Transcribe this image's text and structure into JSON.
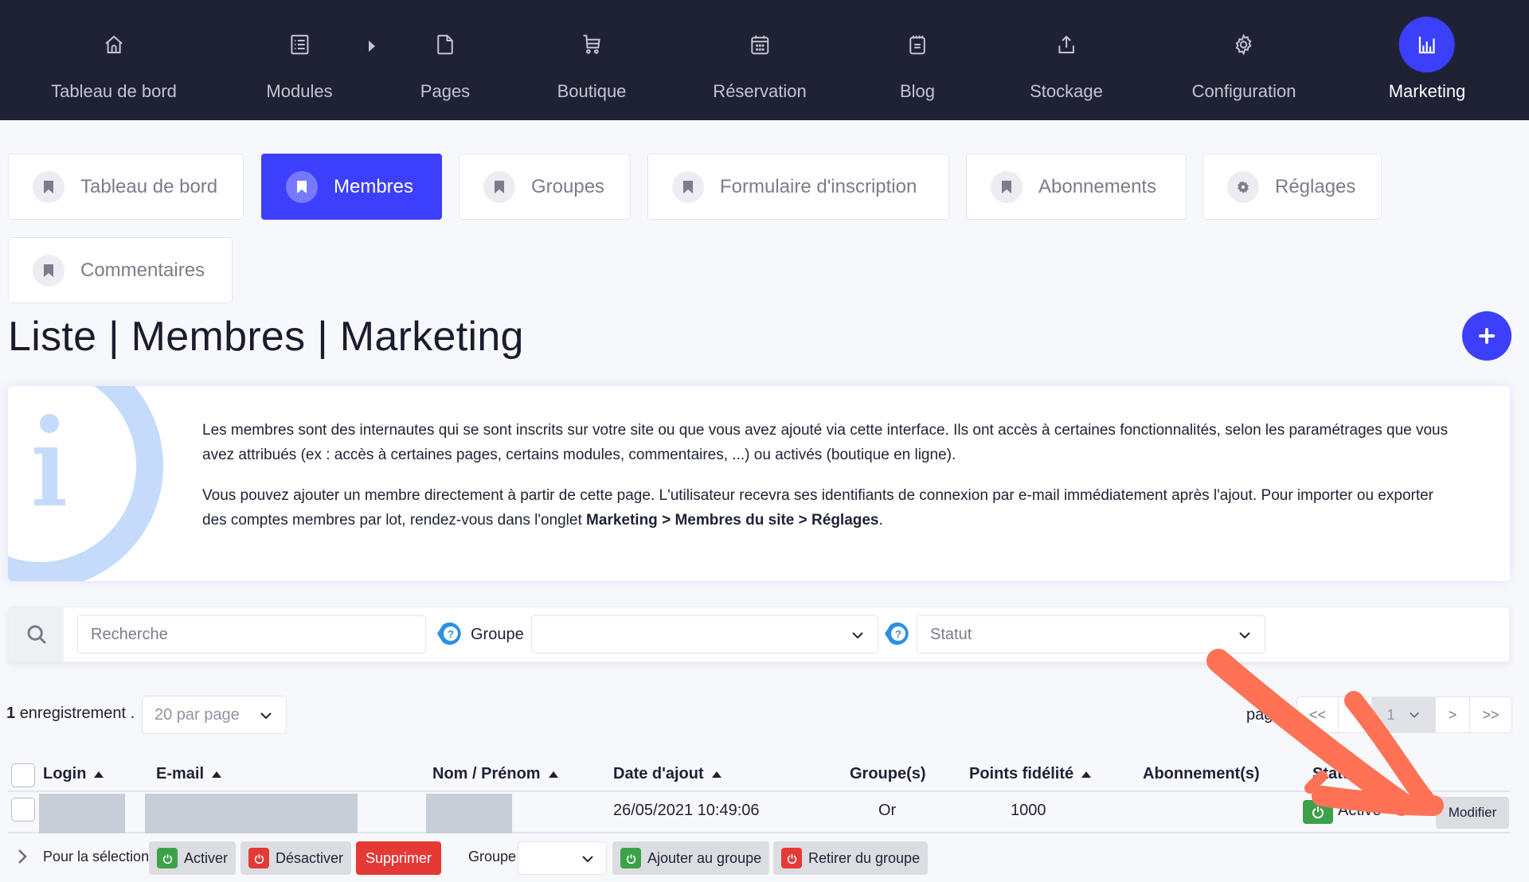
{
  "topnav": {
    "items": [
      {
        "label": "Tableau de bord",
        "icon": "home-icon"
      },
      {
        "label": "Modules",
        "icon": "list-icon"
      },
      {
        "label": "Pages",
        "icon": "page-icon"
      },
      {
        "label": "Boutique",
        "icon": "cart-icon"
      },
      {
        "label": "Réservation",
        "icon": "calendar-icon"
      },
      {
        "label": "Blog",
        "icon": "notepad-icon"
      },
      {
        "label": "Stockage",
        "icon": "upload-icon"
      },
      {
        "label": "Configuration",
        "icon": "gear-icon"
      },
      {
        "label": "Marketing",
        "icon": "bar-chart-icon",
        "active": true
      }
    ],
    "accent": "#3c3ffb",
    "background": "#1f2235"
  },
  "subtabs": [
    {
      "label": "Tableau de bord",
      "icon": "bookmark-icon"
    },
    {
      "label": "Membres",
      "icon": "bookmark-icon",
      "active": true
    },
    {
      "label": "Groupes",
      "icon": "bookmark-icon"
    },
    {
      "label": "Formulaire d'inscription",
      "icon": "bookmark-icon"
    },
    {
      "label": "Abonnements",
      "icon": "bookmark-icon"
    },
    {
      "label": "Réglages",
      "icon": "gear-icon"
    },
    {
      "label": "Commentaires",
      "icon": "bookmark-icon"
    }
  ],
  "page": {
    "title": "Liste | Membres | Marketing",
    "add_button_icon": "plus-icon"
  },
  "info": {
    "p1": "Les membres sont des internautes qui se sont inscrits sur votre site ou que vous avez ajouté via cette interface. Ils ont accès à certaines fonctionnalités, selon les paramétrages que vous avez attribués (ex : accès à certaines pages, certains modules, commentaires, ...) ou activés (boutique en ligne).",
    "p2_start": "Vous pouvez ajouter un membre directement à partir de cette page. L'utilisateur recevra ses identifiants de connexion par e-mail immédiatement après l'ajout. Pour importer ou exporter des comptes membres par lot, rendez-vous dans l'onglet ",
    "p2_bold": "Marketing > Membres du site > Réglages",
    "p2_end": "."
  },
  "filters": {
    "search_placeholder": "Recherche",
    "group_label": "Groupe",
    "group_value": "",
    "status_placeholder": "Statut"
  },
  "listing": {
    "count": "1",
    "count_suffix": "enregistrement .",
    "per_page": "20 par page",
    "page_label": "page",
    "pager": {
      "first": "<<",
      "prev": "<",
      "current": "1",
      "next": ">",
      "last": ">>"
    }
  },
  "table": {
    "headers": {
      "login": "Login",
      "email": "E-mail",
      "name": "Nom / Prénom",
      "date": "Date d'ajout",
      "groups": "Groupe(s)",
      "points": "Points fidélité",
      "subscriptions": "Abonnement(s)",
      "status": "Statut"
    },
    "rows": [
      {
        "login": "",
        "email": "",
        "name": "",
        "date": "26/05/2021 10:49:06",
        "groups": "Or",
        "points": "1000",
        "subscriptions": "",
        "status": "Active",
        "action": "Modifier"
      }
    ]
  },
  "bulk": {
    "label": "Pour la sélection",
    "activate": "Activer",
    "deactivate": "Désactiver",
    "delete": "Supprimer",
    "group_label": "Groupe",
    "add_to_group": "Ajouter au groupe",
    "remove_from_group": "Retirer du groupe"
  },
  "colors": {
    "success": "#3da14a",
    "danger": "#e53935",
    "annotation": "#ff7256"
  }
}
